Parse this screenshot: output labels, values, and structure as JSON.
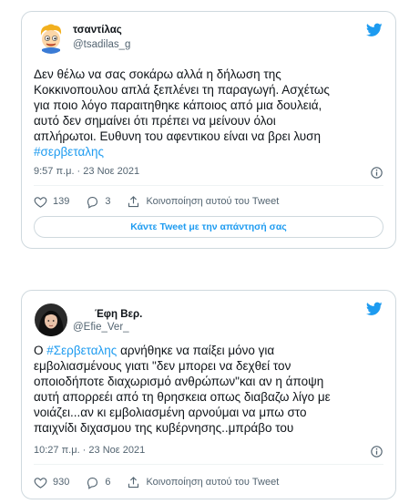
{
  "tweets": [
    {
      "display_name": "τσαντίλας",
      "handle": "@tsadilas_g",
      "text_lines": [
        "Δεν θέλω να σας σοκάρω αλλά η δήλωση της",
        "Κοκκινοπουλου απλά ξεπλένει τη παραγωγή. Ασχέτως",
        "για ποιο λόγο παραιτηθηκε κάποιος από μια δουλειά,",
        "αυτό δεν σημαίνει ότι πρέπει να μείνουν όλοι",
        "απλήρωτοι. Ευθυνη του αφεντικου είναι να βρει λυση"
      ],
      "hashtag": "#σερβεταλης",
      "timestamp": "9:57 π.μ. · 23 Νοε 2021",
      "likes": "139",
      "replies": "3",
      "share_label": "Κοινοποίηση αυτού του Tweet",
      "reply_button_label": "Κάντε Tweet με την απάντησή σας"
    },
    {
      "display_name": "Έφη Βερ.",
      "handle": "@Efie_Ver_",
      "text_prefix": "Ο ",
      "hashtag": "#Σερβεταλης",
      "text_suffix": " αρνήθηκε να παίξει μόνο για\nεμβολιασμένους γιατι \"δεν μπορει να δεχθεί τον\nοποιοδήποτε διαχωρισμό ανθρώπων\"και αν η άποψη\nαυτή απορρεέι από τη θρησκεια οπως διαβαζω λίγο με\nνοιάζει...αν κι εμβολιασμένη αρνούμαι να μπω στο\nπαιχνίδι διχασμου της κυβέρνησης..μπράβο του",
      "timestamp": "10:27 π.μ. · 23 Νοε 2021",
      "likes": "930",
      "replies": "6",
      "share_label": "Κοινοποίηση αυτού του Tweet"
    }
  ],
  "colors": {
    "accent": "#1d9bf0",
    "text": "#0f1419",
    "muted": "#536471",
    "border": "#cfd9de"
  },
  "icons": [
    "twitter-bird-icon",
    "info-icon",
    "heart-icon",
    "reply-icon",
    "share-icon"
  ]
}
